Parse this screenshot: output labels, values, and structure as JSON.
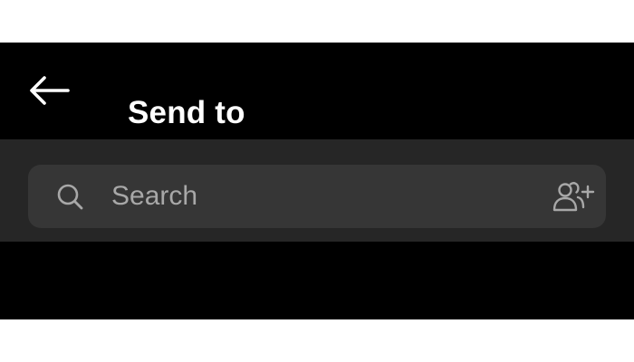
{
  "header": {
    "back_icon": "arrow-left-icon",
    "title": "Send to"
  },
  "search": {
    "icon": "search-icon",
    "placeholder": "Search",
    "value": "",
    "add_people_icon": "add-people-icon"
  },
  "colors": {
    "background": "#000000",
    "search_band": "#262626",
    "search_box": "#363636",
    "text": "#ffffff",
    "placeholder": "#a8a8a8"
  }
}
